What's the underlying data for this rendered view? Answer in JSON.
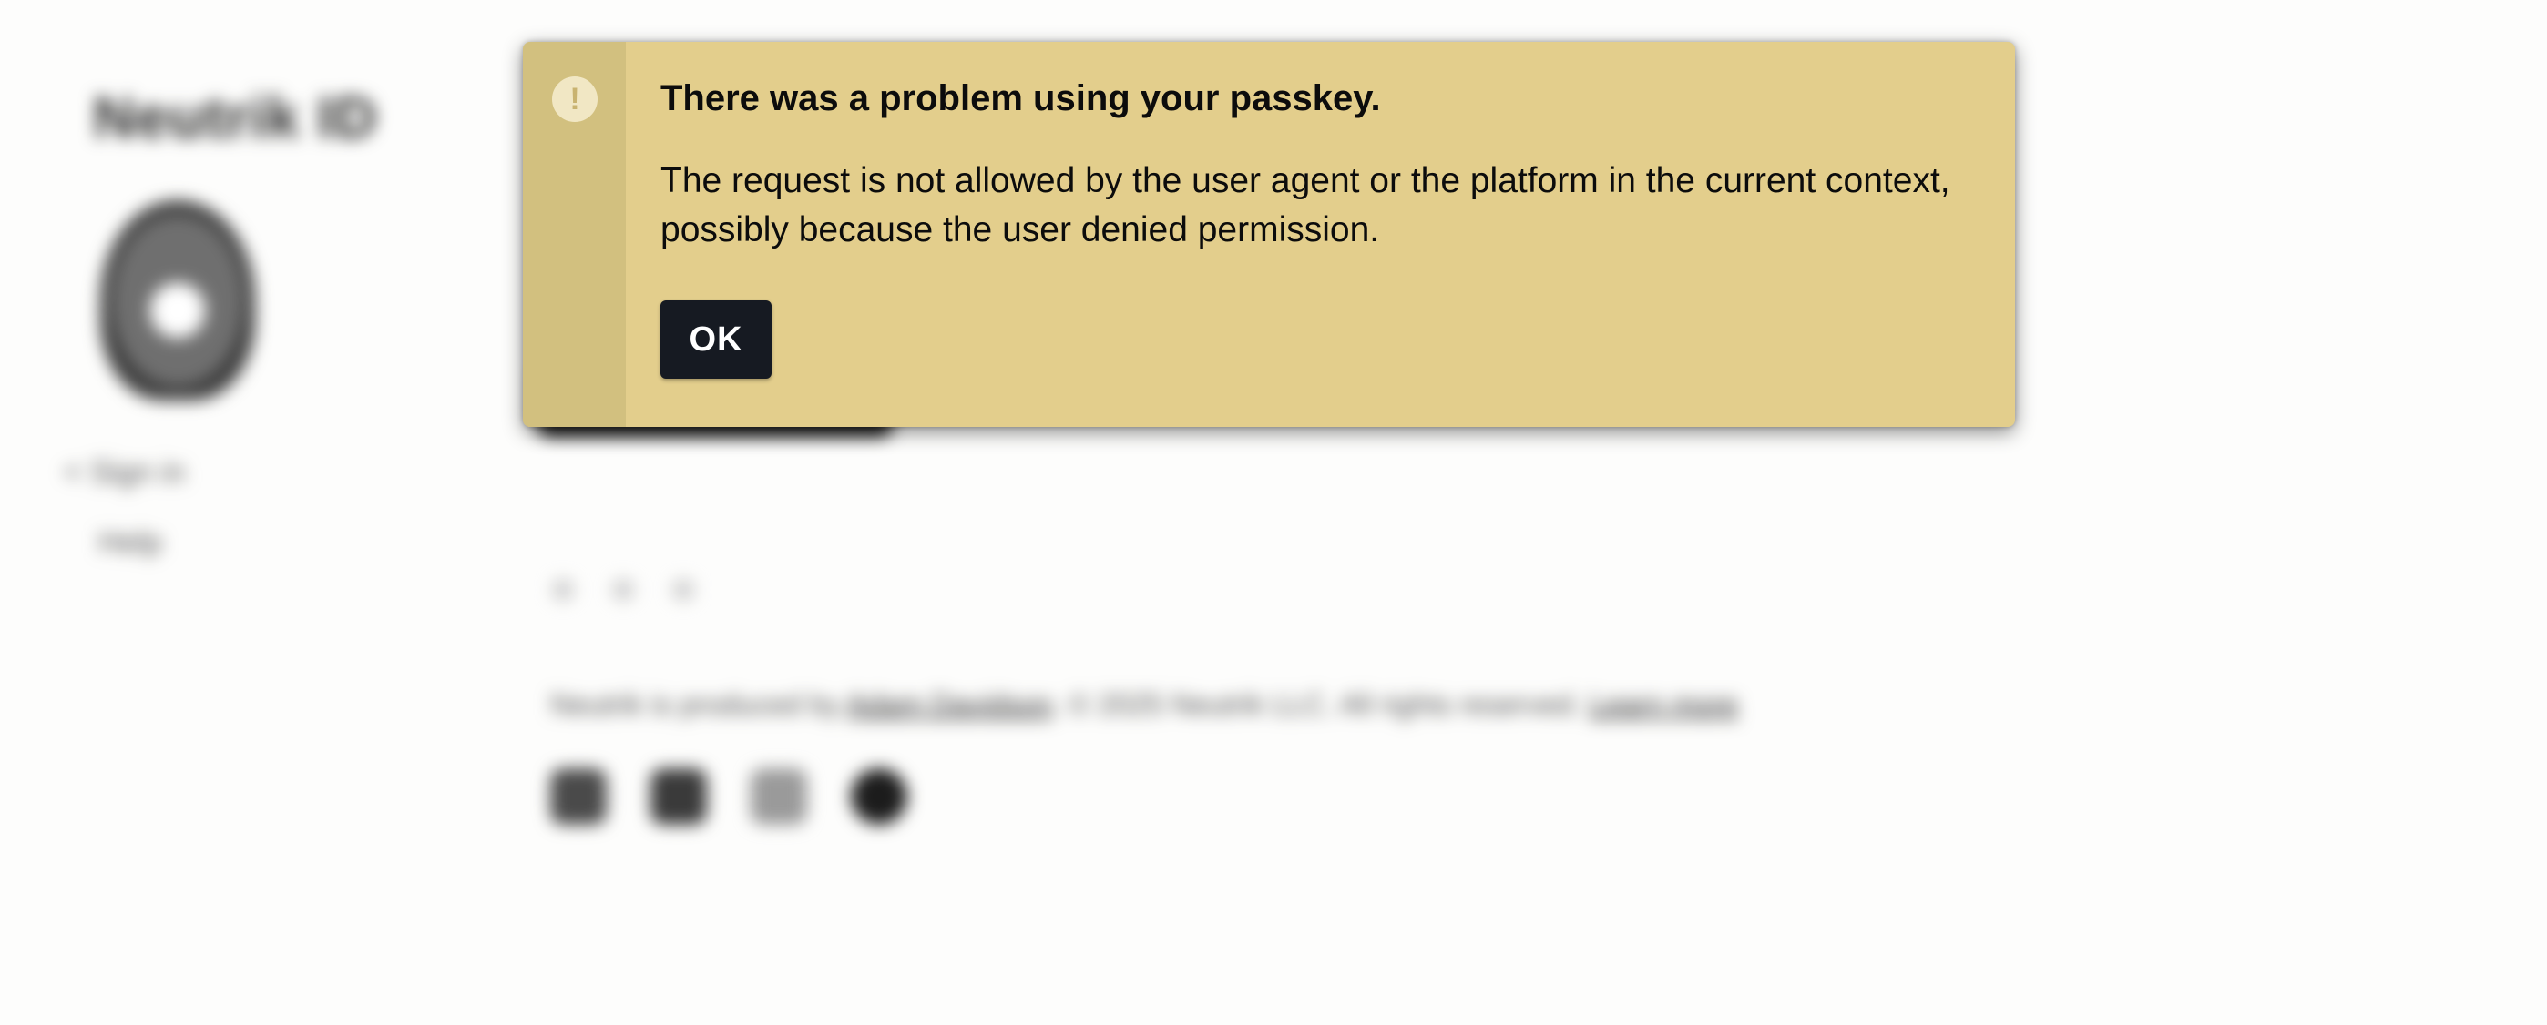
{
  "background": {
    "brand": "Neutrik ID",
    "nav": [
      "< Sign in",
      "Help"
    ],
    "footer_prefix": "Neutrik is produced by ",
    "footer_link": "Adam Davidson",
    "footer_suffix": ". © 2025 Neutrik LLC. All rights reserved. ",
    "footer_link2": "Learn more"
  },
  "alert": {
    "icon": "!",
    "title": "There was a problem using your passkey.",
    "message": "The request is not allowed by the user agent or the platform in the current context, possibly because the user denied permission.",
    "ok_label": "OK"
  },
  "colors": {
    "alert_bg": "#e3ce8c",
    "alert_side": "#d2c07f",
    "button_bg": "#161a22"
  }
}
